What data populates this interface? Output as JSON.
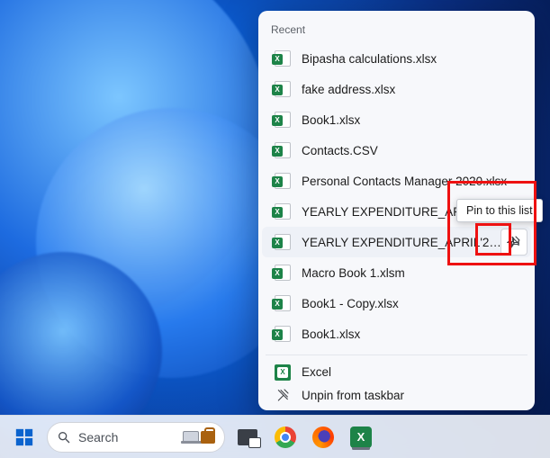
{
  "jumplist": {
    "header": "Recent",
    "items": [
      {
        "label": "Bipasha calculations.xlsx"
      },
      {
        "label": "fake address.xlsx"
      },
      {
        "label": "Book1.xlsx"
      },
      {
        "label": "Contacts.CSV"
      },
      {
        "label": "Personal Contacts Manager 2020.xlsx"
      },
      {
        "label": "YEARLY EXPENDITURE_APRIL'21-MARCH'22.xlsx"
      },
      {
        "label": "YEARLY EXPENDITURE_APRIL'2…",
        "hovered": true
      },
      {
        "label": "Macro Book 1.xlsm"
      },
      {
        "label": "Book1 - Copy.xlsx"
      },
      {
        "label": "Book1.xlsx"
      }
    ],
    "app_row": {
      "label": "Excel"
    },
    "unpin_row": {
      "label": "Unpin from taskbar"
    }
  },
  "tooltip": {
    "text": "Pin to this list"
  },
  "taskbar": {
    "search_placeholder": "Search"
  }
}
